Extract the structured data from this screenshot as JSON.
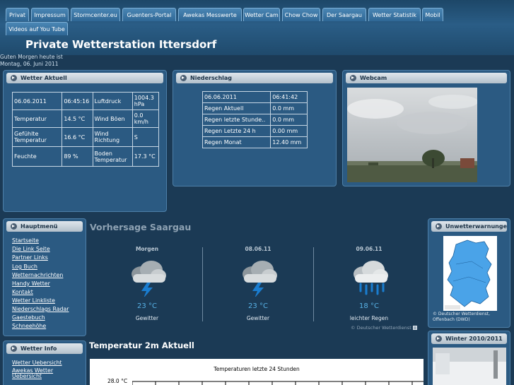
{
  "nav": {
    "tabs": [
      "Privat",
      "Impressum",
      "Stormcenter.eu",
      "Guenters-Portal",
      "Awekas Messwerte",
      "Wetter Cam",
      "Chow Chow",
      "Der Saargau",
      "Wetter Statistik",
      "Mobil",
      "Videos auf You Tube"
    ]
  },
  "header": {
    "title": "Private Wetterstation Ittersdorf",
    "greeting": "Guten Morgen heute ist",
    "date": "Montag, 06. Juni 2011"
  },
  "wetter_aktuell": {
    "title": "Wetter Aktuell",
    "rows": [
      [
        "06.06.2011",
        "06:45:16",
        "Luftdruck",
        "1004.3 hPa"
      ],
      [
        "Temperatur",
        "14.5 °C",
        "Wind Böen",
        "0.0 km/h"
      ],
      [
        "Gefühlte Temperatur",
        "16.6 °C",
        "Wind Richtung",
        "S"
      ],
      [
        "Feuchte",
        "89 %",
        "Boden Temperatur",
        "17.3 °C"
      ]
    ]
  },
  "niederschlag": {
    "title": "Niederschlag",
    "rows": [
      [
        "06.06.2011",
        "06:41:42"
      ],
      [
        "Regen Aktuell",
        "0.0 mm"
      ],
      [
        "Regen letzte Stunde..",
        "0.0 mm"
      ],
      [
        "Regen Letzte 24 h",
        "0.00 mm"
      ],
      [
        "Regen Monat",
        "12.40 mm"
      ]
    ]
  },
  "webcam": {
    "title": "Webcam"
  },
  "hauptmenue": {
    "title": "Hauptmenü",
    "items": [
      "Startseite",
      "Die Link Seite",
      "Partner Links",
      "Log Buch",
      "Wetternachrichten",
      "Handy Wetter",
      "Kontakt",
      "Wetter Linkliste",
      "Niederschlags Radar",
      "Gaestebuch",
      "Schneehöhe"
    ]
  },
  "wetter_info": {
    "title": "Wetter Info",
    "items": [
      "Wetter Uebersicht",
      "Awekas Wetter Uebersicht"
    ]
  },
  "forecast": {
    "title": "Vorhersage Saargau",
    "days": [
      {
        "day": "Morgen",
        "temp": "23 °C",
        "desc": "Gewitter",
        "icon": "thunderstorm-icon"
      },
      {
        "day": "08.06.11",
        "temp": "23 °C",
        "desc": "Gewitter",
        "icon": "thunderstorm-icon"
      },
      {
        "day": "09.06.11",
        "temp": "18 °C",
        "desc": "leichter Regen",
        "icon": "rain-icon"
      }
    ],
    "credit": "© Deutscher Wetterdienst"
  },
  "unwetter": {
    "title": "Unwetterwarnungen",
    "credit": "© Deutscher Wetterdienst, Offenbach (DWD)"
  },
  "winter": {
    "title": "Winter 2010/2011"
  },
  "temperature": {
    "title": "Temperatur 2m Aktuell",
    "chart_title": "Temperaturen letzte 24 Stunden",
    "y_top_label": "28.0 °C"
  },
  "colors": {
    "background": "#1b3a55",
    "panel": "#2b5a82",
    "tab": "#3a77a8",
    "forecast_temp": "#58b2e6"
  }
}
